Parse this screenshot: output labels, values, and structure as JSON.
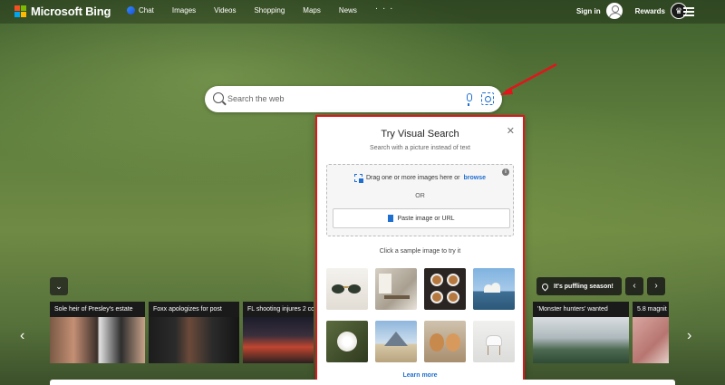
{
  "brand": {
    "name": "Microsoft Bing",
    "colors": [
      "#f25022",
      "#7fba00",
      "#00a4ef",
      "#ffb900"
    ]
  },
  "nav": {
    "items": [
      "Chat",
      "Images",
      "Videos",
      "Shopping",
      "Maps",
      "News"
    ],
    "more": "· · ·"
  },
  "header": {
    "signin": "Sign in",
    "rewards": "Rewards"
  },
  "search": {
    "placeholder": "Search the web"
  },
  "visual_search": {
    "title": "Try Visual Search",
    "subtitle": "Search with a picture instead of text",
    "drag_text": "Drag one or more images here or",
    "browse": "browse",
    "or": "OR",
    "paste": "Paste image or URL",
    "sample_label": "Click a sample image to try it",
    "learn_more": "Learn more",
    "samples": [
      "sunglasses",
      "dining-room",
      "coffee-cups",
      "opera-house",
      "white-rose",
      "louvre-pyramid",
      "puppies",
      "white-chair"
    ]
  },
  "news": {
    "cards": [
      "Sole heir of Presley's estate",
      "Foxx apologizes for post",
      "FL shooting injures 2 co",
      "'Monster hunters' wanted",
      "5.8 magnit"
    ]
  },
  "pill": {
    "label": "It's puffling season!"
  },
  "accent": "#1f6fd0",
  "highlight": "#e0161b"
}
